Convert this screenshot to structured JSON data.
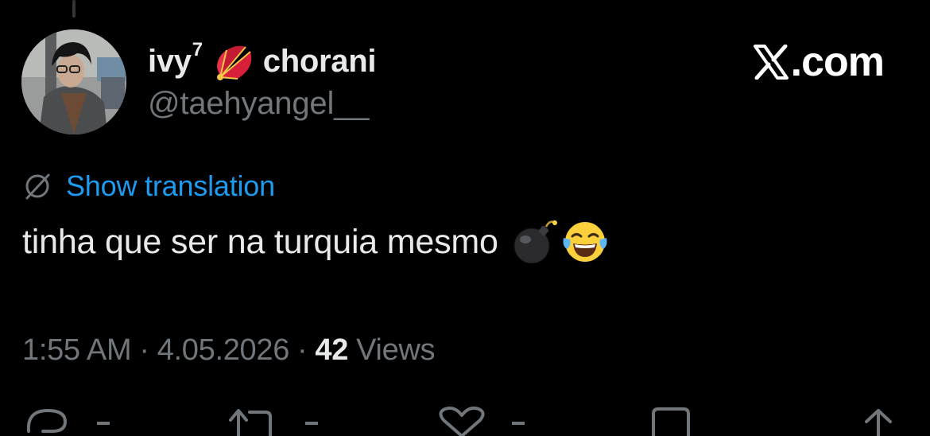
{
  "user": {
    "display_name": "ivy",
    "display_name_superscript": "7",
    "display_name_suffix": "chorani",
    "handle": "@taehyangel__",
    "avatar_icon": "avatar-photo",
    "name_emoji": "folding-fan-icon"
  },
  "brand": {
    "text": ".com",
    "icon": "x-logo-icon"
  },
  "translation": {
    "link_text": "Show translation",
    "icon": "globe-icon"
  },
  "tweet": {
    "text": "tinha que ser na turquia mesmo",
    "emojis": [
      "bomb-emoji",
      "face-with-tears-of-joy-emoji"
    ]
  },
  "meta": {
    "time": "1:55 AM",
    "separator": "·",
    "date": "4.05.2026",
    "views_count": "42",
    "views_label": "Views"
  },
  "actions": {
    "icons": [
      "reply-icon",
      "retweet-icon",
      "like-icon",
      "bookmark-icon",
      "share-icon"
    ]
  },
  "colors": {
    "background": "#000000",
    "primary_text": "#e7e9ea",
    "secondary_text": "#71767b",
    "link": "#1d9bf0"
  }
}
